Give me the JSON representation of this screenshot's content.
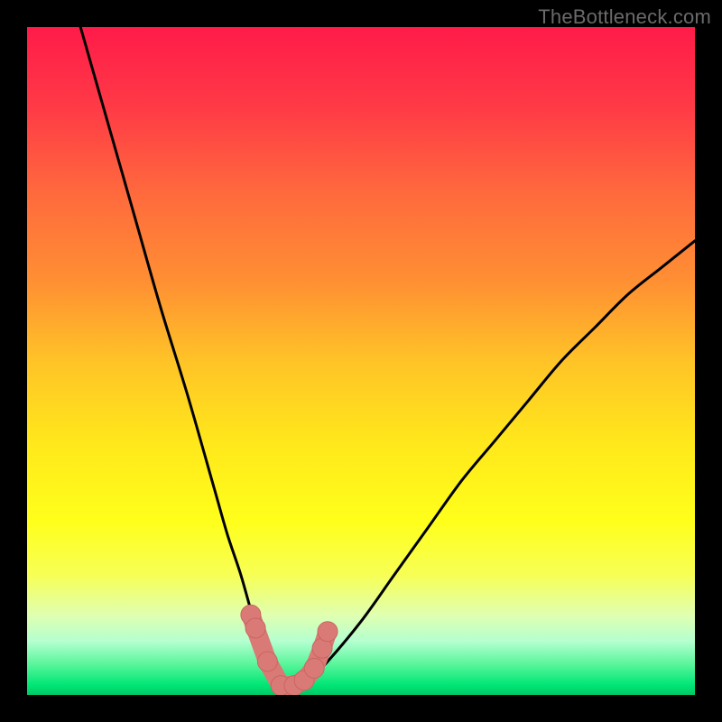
{
  "watermark": "TheBottleneck.com",
  "colors": {
    "frame": "#000000",
    "curve_stroke": "#000000",
    "marker_fill": "#da7a77",
    "marker_stroke": "#c96561",
    "gradient_stops": [
      {
        "offset": 0.0,
        "color": "#ff1b49"
      },
      {
        "offset": 0.12,
        "color": "#ff3a46"
      },
      {
        "offset": 0.25,
        "color": "#ff6a3d"
      },
      {
        "offset": 0.38,
        "color": "#ff8f33"
      },
      {
        "offset": 0.5,
        "color": "#ffc327"
      },
      {
        "offset": 0.62,
        "color": "#ffe71b"
      },
      {
        "offset": 0.74,
        "color": "#ffff1b"
      },
      {
        "offset": 0.82,
        "color": "#f7ff55"
      },
      {
        "offset": 0.88,
        "color": "#e0ffb0"
      },
      {
        "offset": 0.92,
        "color": "#b4ffd0"
      },
      {
        "offset": 0.955,
        "color": "#57f59a"
      },
      {
        "offset": 0.985,
        "color": "#00e676"
      },
      {
        "offset": 1.0,
        "color": "#00c965"
      }
    ]
  },
  "chart_data": {
    "type": "line",
    "title": "",
    "xlabel": "",
    "ylabel": "",
    "xlim": [
      0,
      100
    ],
    "ylim": [
      0,
      100
    ],
    "grid": false,
    "series": [
      {
        "name": "bottleneck-curve",
        "x": [
          8,
          12,
          16,
          20,
          24,
          28,
          30,
          32,
          34,
          36,
          37,
          38,
          40,
          42,
          45,
          50,
          55,
          60,
          65,
          70,
          75,
          80,
          85,
          90,
          95,
          100
        ],
        "y": [
          100,
          86,
          72,
          58,
          45,
          31,
          24,
          18,
          11,
          5,
          2,
          1,
          1,
          2,
          5,
          11,
          18,
          25,
          32,
          38,
          44,
          50,
          55,
          60,
          64,
          68
        ]
      }
    ],
    "markers": {
      "name": "optimal-region",
      "x": [
        33.5,
        34.2,
        36.0,
        38.0,
        40.0,
        41.5,
        43.0,
        44.2,
        45.0
      ],
      "y": [
        12.0,
        10.0,
        5.0,
        1.4,
        1.4,
        2.2,
        4.0,
        7.0,
        9.5
      ]
    }
  }
}
